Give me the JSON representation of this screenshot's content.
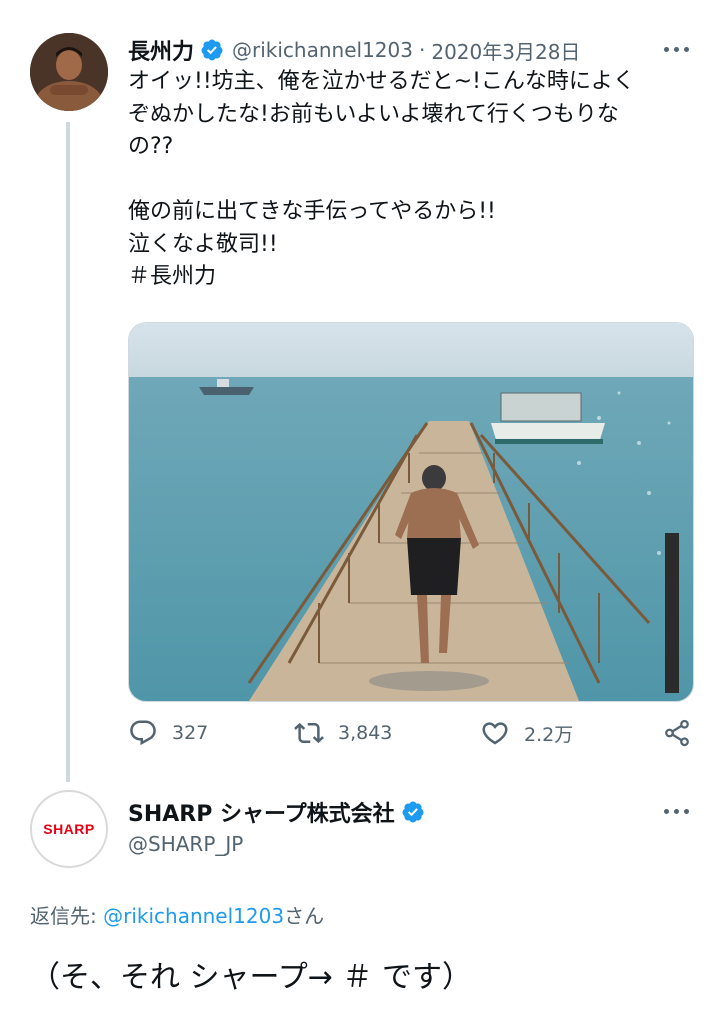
{
  "tweet1": {
    "display_name": "長州力",
    "handle": "@rikichannel1203",
    "date": "2020年3月28日",
    "separator": "·",
    "text_lines": [
      "オイッ!!坊主、俺を泣かせるだと~!こんな時によく",
      "ぞぬかしたな!お前もいよいよ壊れて行くつもりな",
      "の??",
      "",
      "俺の前に出てきな手伝ってやるから!!",
      "泣くなよ敬司!!",
      "＃長州力"
    ],
    "replies": "327",
    "retweets": "3,843",
    "likes": "2.2万"
  },
  "tweet2": {
    "display_name": "SHARP シャープ株式会社",
    "handle": "@SHARP_JP",
    "avatar_logo": "SHARP",
    "reply_to_prefix": "返信先: ",
    "reply_to_handle": "@rikichannel1203",
    "reply_to_suffix": "さん",
    "text": "（そ、それ シャープ→ ＃ です）"
  },
  "icons": {
    "verified": "verified-badge-icon",
    "more": "more-icon",
    "reply": "reply-icon",
    "retweet": "retweet-icon",
    "like": "heart-icon",
    "share": "share-icon"
  },
  "colors": {
    "accent": "#1d9bf0",
    "muted": "#536471",
    "sharp_red": "#e60012"
  }
}
